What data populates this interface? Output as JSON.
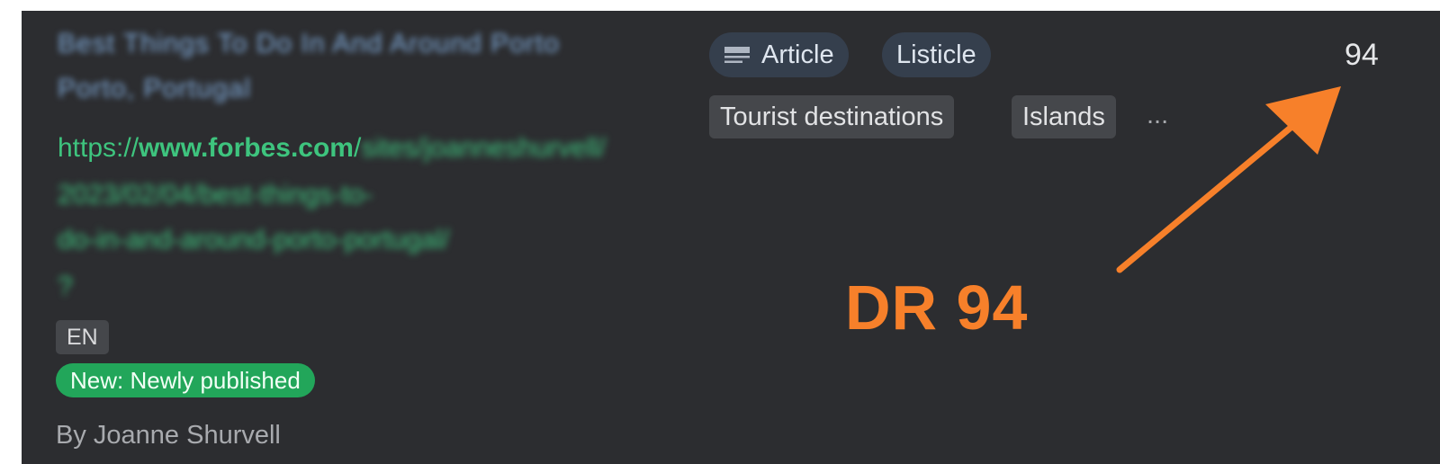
{
  "article": {
    "title_line1": "Best Things To Do In And Around Porto",
    "title_line2": "Porto, Portugal",
    "url_visible": "https://www.forbes.com/",
    "url_prefix": "https://",
    "url_domain": "www.forbes.com",
    "url_slash": "/",
    "url_rest_line1": "sites/joanneshurvell/",
    "url_rest_line2": "2023/02/04/best-things-to-",
    "url_rest_line3": "do-in-and-around-porto-portugal/",
    "url_rest_line4": "?",
    "language": "EN",
    "status_badge": "New: Newly published",
    "author": "By Joanne Shurvell"
  },
  "tags": {
    "types": [
      "Article",
      "Listicle"
    ],
    "topics": [
      "Tourist destinations",
      "Islands"
    ],
    "more": "..."
  },
  "domain_rating": "94",
  "annotation": {
    "label": "DR 94",
    "color": "#f7802a"
  },
  "colors": {
    "panel_bg": "#2c2d30",
    "url_green": "#3ec47e",
    "title_blue": "#7fa9d8",
    "badge_green": "#22a65a"
  },
  "icons": {
    "article_type": "document-lines-icon"
  }
}
